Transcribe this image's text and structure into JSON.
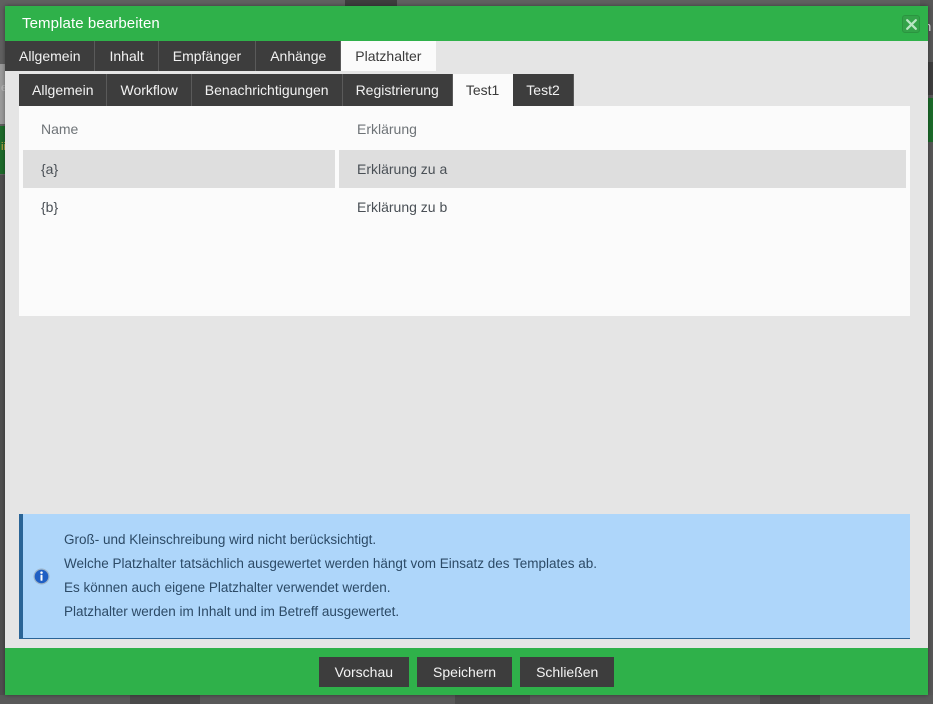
{
  "backdrop": {
    "ghost_left_1": "e",
    "ghost_left_2": "ii",
    "ghost_right_1": "r",
    "ghost_right_2": "n"
  },
  "modal": {
    "title": "Template bearbeiten",
    "close_icon": "close-icon",
    "close_label": "×"
  },
  "outer_tabs": [
    {
      "label": "Allgemein",
      "active": false
    },
    {
      "label": "Inhalt",
      "active": false
    },
    {
      "label": "Empfänger",
      "active": false
    },
    {
      "label": "Anhänge",
      "active": false
    },
    {
      "label": "Platzhalter",
      "active": true
    }
  ],
  "inner_tabs": [
    {
      "label": "Allgemein",
      "active": false
    },
    {
      "label": "Workflow",
      "active": false
    },
    {
      "label": "Benachrichtigungen",
      "active": false
    },
    {
      "label": "Registrierung",
      "active": false
    },
    {
      "label": "Test1",
      "active": true
    },
    {
      "label": "Test2",
      "active": false
    }
  ],
  "table": {
    "columns": [
      "Name",
      "Erklärung"
    ],
    "rows": [
      {
        "name": "{a}",
        "explanation": "Erklärung zu a",
        "highlighted": true
      },
      {
        "name": "{b}",
        "explanation": "Erklärung zu b",
        "highlighted": false
      }
    ]
  },
  "info_box": {
    "icon": "info-circle-icon",
    "lines": [
      "Groß- und Kleinschreibung wird nicht berücksichtigt.",
      "Welche Platzhalter tatsächlich ausgewertet werden hängt vom Einsatz des Templates ab.",
      "Es können auch eigene Platzhalter verwendet werden.",
      "Platzhalter werden im Inhalt und im Betreff ausgewertet."
    ]
  },
  "footer": {
    "buttons": [
      {
        "label": "Vorschau"
      },
      {
        "label": "Speichern"
      },
      {
        "label": "Schließen"
      }
    ]
  },
  "colors": {
    "brand_green": "#2fb14a",
    "tab_dark": "#3d3d3d",
    "panel_bg": "#e5e5e5",
    "card_bg": "#fbfbfb",
    "row_highlight": "#dedede",
    "info_bg": "#aed6fa",
    "info_border": "#2a6496",
    "backdrop": "#606060"
  }
}
